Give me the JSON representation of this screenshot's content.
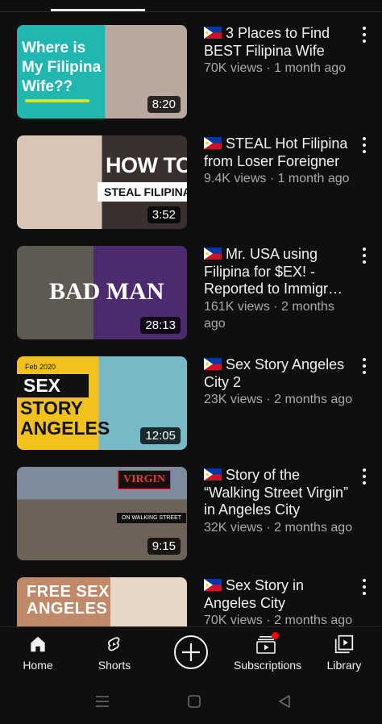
{
  "videos": [
    {
      "title": "3 Places to Find BEST Filipina Wife",
      "stats": "70K views · 1 month ago",
      "duration": "8:20",
      "thumb_text": "Where is My Filipina Wife??"
    },
    {
      "title": "STEAL Hot Filipina from Loser Foreigner",
      "stats": "9.4K views · 1 month ago",
      "duration": "3:52",
      "thumb_text_1": "HOW TO",
      "thumb_text_2": "STEAL FILIPINA"
    },
    {
      "title": "Mr. USA using Filipina for $EX! - Reported to Immigr…",
      "stats": "161K views · 2 months ago",
      "duration": "28:13",
      "thumb_text": "BAD MAN"
    },
    {
      "title": "Sex Story Angeles City 2",
      "stats": "23K views · 2 months ago",
      "duration": "12:05",
      "thumb_text_date": "Feb 2020",
      "thumb_text_1": "SEX",
      "thumb_text_2": "STORY",
      "thumb_text_3": "ANGELES"
    },
    {
      "title": "Story of the “Walking Street Virgin” in Angeles City",
      "stats": "32K views · 2 months ago",
      "duration": "9:15",
      "thumb_text_1": "VIRGIN",
      "thumb_text_2": "ON WALKING STREET"
    },
    {
      "title": "Sex Story in Angeles City",
      "stats": "70K views · 2 months ago",
      "thumb_text": "FREE SEX ANGELES"
    }
  ],
  "nav": {
    "home": "Home",
    "shorts": "Shorts",
    "subscriptions": "Subscriptions",
    "library": "Library"
  },
  "icons": {
    "flag": "philippines-flag-icon",
    "more": "more-vert-icon",
    "home": "home-icon",
    "shorts": "shorts-icon",
    "create": "create-plus-icon",
    "subscriptions": "subscriptions-icon",
    "library": "library-icon"
  },
  "colors": {
    "background": "#0f0f0f",
    "text": "#f1f1f1",
    "secondary_text": "#aaaaaa",
    "notification": "#ff0000"
  }
}
